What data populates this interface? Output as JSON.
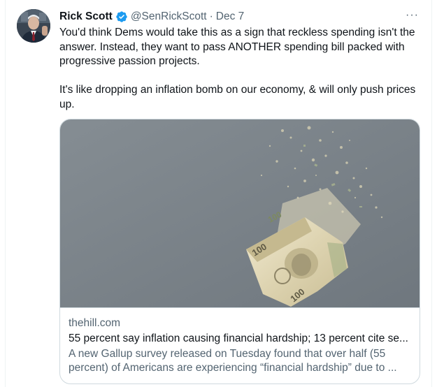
{
  "tweet": {
    "author_name": "Rick Scott",
    "handle": "@SenRickScott",
    "separator": "·",
    "date": "Dec 7",
    "more_label": "···",
    "text_paragraph_1": "You'd think Dems would take this as a sign that reckless spending isn't the answer. Instead, they want to pass ANOTHER spending bill packed with progressive passion projects.",
    "text_paragraph_2": "It's like dropping an inflation bomb on our economy, & will only push prices up."
  },
  "card": {
    "domain": "thehill.com",
    "title": "55 percent say inflation causing financial hardship; 13 percent cite se...",
    "description": "A new Gallup survey released on Tuesday found that over half (55 percent) of Americans are experiencing “financial hardship” due to ...",
    "image_banknote_text": [
      "100",
      "100",
      "100"
    ]
  },
  "colors": {
    "verified_blue": "#1d9bf0",
    "secondary_text": "#536471",
    "card_border": "#cfd9de",
    "image_background": "#7d858c"
  },
  "icons": {
    "verified": "verified-badge-icon",
    "more": "more-horizontal-icon"
  }
}
